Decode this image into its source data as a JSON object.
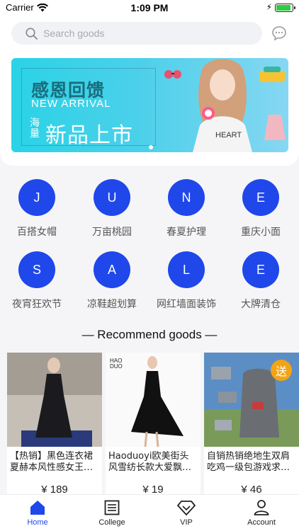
{
  "status_bar": {
    "carrier": "Carrier",
    "time": "1:09 PM",
    "battery_level": 0.95
  },
  "search": {
    "placeholder": "Search goods"
  },
  "banner": {
    "title": "感恩回馈",
    "subtitle": "NEW ARRIVAL",
    "side_text": "海量",
    "headline": "新品上市",
    "colors": {
      "from": "#2ad3e6",
      "to": "#86d7f2"
    }
  },
  "categories": [
    {
      "letter": "J",
      "label": "百搭女帽"
    },
    {
      "letter": "U",
      "label": "万亩桃园"
    },
    {
      "letter": "N",
      "label": "春夏护理"
    },
    {
      "letter": "E",
      "label": "重庆小面"
    },
    {
      "letter": "S",
      "label": "夜宵狂欢节"
    },
    {
      "letter": "A",
      "label": "凉鞋超划算"
    },
    {
      "letter": "L",
      "label": "网红墙面装饰"
    },
    {
      "letter": "E",
      "label": "大牌清仓"
    }
  ],
  "recommend": {
    "title": "— Recommend goods —"
  },
  "goods": [
    {
      "line1": "【热销】黑色连衣裙",
      "line2": "夏赫本风性感女王…",
      "price": "¥ 189"
    },
    {
      "line1": "Haoduoyi欧美街头",
      "line2": "风雪纺长款大爱飘…",
      "price": "¥ 19"
    },
    {
      "line1": "自销热销绝地生双肩",
      "line2": "吃鸡一级包游戏求…",
      "price": "¥ 46",
      "badge": "送"
    }
  ],
  "tabs": [
    {
      "label": "Home",
      "icon": "home-icon",
      "active": true
    },
    {
      "label": "College",
      "icon": "book-icon",
      "active": false
    },
    {
      "label": "VIP",
      "icon": "diamond-icon",
      "active": false
    },
    {
      "label": "Account",
      "icon": "person-icon",
      "active": false
    }
  ],
  "accent_color": "#1f47ea"
}
